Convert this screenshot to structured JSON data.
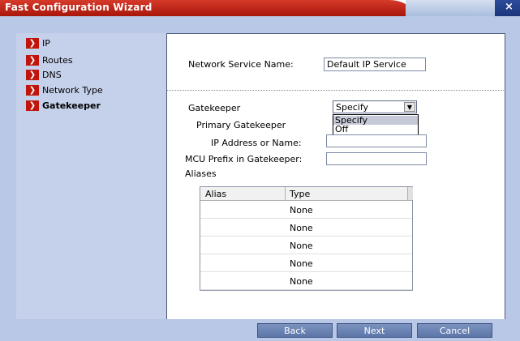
{
  "window": {
    "title": "Fast Configuration Wizard",
    "close_glyph": "×"
  },
  "sidebar": {
    "items": [
      {
        "label": "IP",
        "active": false
      },
      {
        "label": "Routes",
        "active": false
      },
      {
        "label": "DNS",
        "active": false
      },
      {
        "label": "Network Type",
        "active": false
      },
      {
        "label": "Gatekeeper",
        "active": true
      }
    ],
    "arrow_icon": "chevron-right-icon"
  },
  "form": {
    "service_name_label": "Network Service Name:",
    "service_name_value": "Default IP Service",
    "gatekeeper_label": "Gatekeeper",
    "gatekeeper_value": "Specify",
    "gatekeeper_options": [
      "Specify",
      "Off"
    ],
    "primary_gatekeeper_label": "Primary Gatekeeper",
    "ip_label": "IP Address or Name:",
    "ip_value": "",
    "mcu_prefix_label": "MCU Prefix in Gatekeeper:",
    "mcu_prefix_value": "",
    "aliases_label": "Aliases"
  },
  "aliases_table": {
    "columns": [
      "Alias",
      "Type"
    ],
    "rows": [
      {
        "alias": "",
        "type": "None"
      },
      {
        "alias": "",
        "type": "None"
      },
      {
        "alias": "",
        "type": "None"
      },
      {
        "alias": "",
        "type": "None"
      },
      {
        "alias": "",
        "type": "None"
      }
    ]
  },
  "buttons": {
    "back": "Back",
    "next": "Next",
    "cancel": "Cancel"
  },
  "colors": {
    "title_red": "#c0150c",
    "sidebar_bg": "#c5d0ea",
    "button_blue": "#6a83b5"
  }
}
